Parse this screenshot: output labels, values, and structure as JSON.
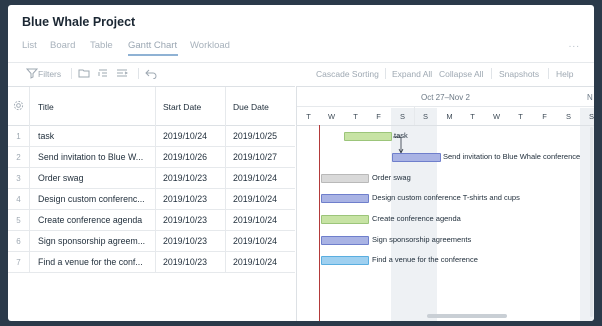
{
  "project": {
    "title": "Blue Whale Project"
  },
  "views": [
    "List",
    "Board",
    "Table",
    "Gantt Chart",
    "Workload"
  ],
  "more_label": "...",
  "toolbar": {
    "filters": "Filters",
    "cascade": "Cascade Sorting",
    "expand": "Expand All",
    "collapse": "Collapse All",
    "snapshots": "Snapshots",
    "help": "Help"
  },
  "grid": {
    "columns": {
      "title": "Title",
      "start": "Start Date",
      "due": "Due Date"
    },
    "rows": [
      {
        "num": "1",
        "title": "task",
        "start": "2019/10/24",
        "due": "2019/10/25"
      },
      {
        "num": "2",
        "title": "Send invitation to Blue W...",
        "start": "2019/10/26",
        "due": "2019/10/27"
      },
      {
        "num": "3",
        "title": "Order swag",
        "start": "2019/10/23",
        "due": "2019/10/24"
      },
      {
        "num": "4",
        "title": "Design custom conferenc...",
        "start": "2019/10/23",
        "due": "2019/10/24"
      },
      {
        "num": "5",
        "title": "Create conference agenda",
        "start": "2019/10/23",
        "due": "2019/10/24"
      },
      {
        "num": "6",
        "title": "Sign sponsorship agreem...",
        "start": "2019/10/23",
        "due": "2019/10/24"
      },
      {
        "num": "7",
        "title": "Find a venue for the conf...",
        "start": "2019/10/23",
        "due": "2019/10/24"
      }
    ]
  },
  "gantt": {
    "range_label": "Oct 27–Nov 2",
    "range_label_next": "N",
    "days": [
      "T",
      "W",
      "T",
      "F",
      "S",
      "S",
      "M",
      "T",
      "W",
      "T",
      "F",
      "S",
      "S"
    ],
    "bars": [
      {
        "label": "task",
        "color": "#c7e3a4",
        "border": "#9cc57a"
      },
      {
        "label": "Send invitation to Blue Whale conference",
        "color": "#a9b3e4",
        "border": "#6f7fcc"
      },
      {
        "label": "Order swag",
        "color": "#d9d9d9",
        "border": "#b9b9b9"
      },
      {
        "label": "Design custom conference T-shirts and cups",
        "color": "#a9b3e4",
        "border": "#6f7fcc"
      },
      {
        "label": "Create conference agenda",
        "color": "#c7e3a4",
        "border": "#9cc57a"
      },
      {
        "label": "Sign sponsorship agreements",
        "color": "#a9b3e4",
        "border": "#6f7fcc"
      },
      {
        "label": "Find a venue for the conference",
        "color": "#9fd0f0",
        "border": "#5aaee0"
      }
    ]
  }
}
